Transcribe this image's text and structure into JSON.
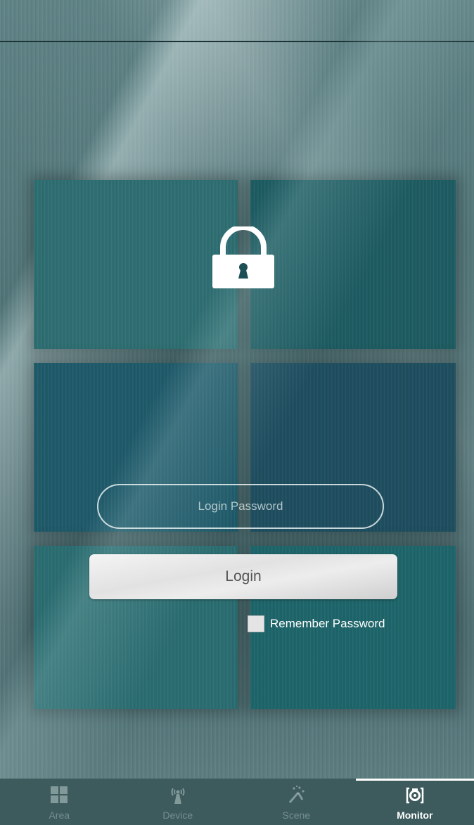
{
  "password": {
    "placeholder": "Login Password",
    "value": ""
  },
  "login_button": {
    "label": "Login"
  },
  "remember": {
    "label": "Remember Password",
    "checked": false
  },
  "tabs": [
    {
      "label": "Area",
      "icon": "grid-icon",
      "active": false
    },
    {
      "label": "Device",
      "icon": "antenna-icon",
      "active": false
    },
    {
      "label": "Scene",
      "icon": "scene-wand-icon",
      "active": false
    },
    {
      "label": "Monitor",
      "icon": "camera-icon",
      "active": true
    }
  ],
  "colors": {
    "tabbar": "#3d5a5d",
    "accent": "#ffffff"
  }
}
